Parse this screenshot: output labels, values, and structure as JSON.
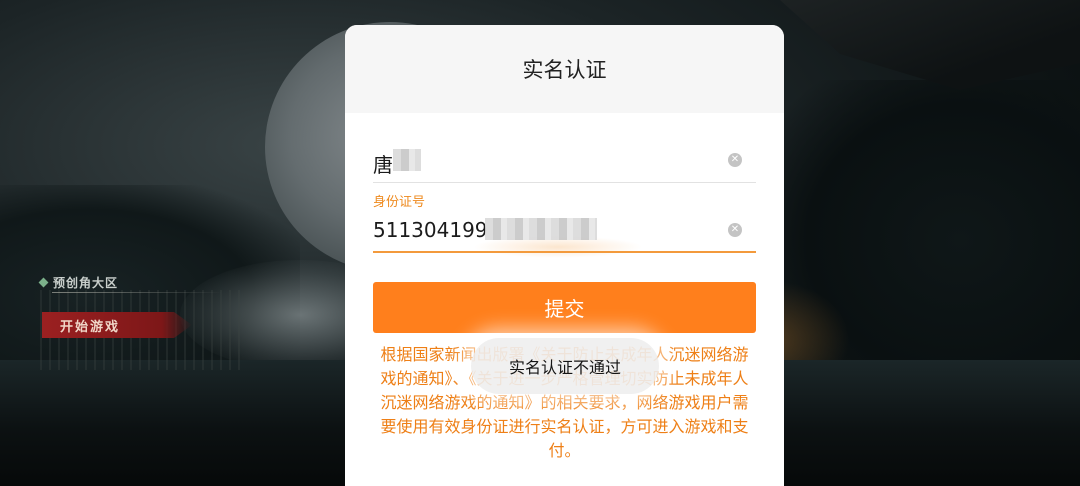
{
  "game_menu": {
    "server_label": "预创角大区",
    "start_label": "开始游戏"
  },
  "dialog": {
    "title": "实名认证",
    "name_field": {
      "value": "唐"
    },
    "id_field": {
      "label": "身份证号",
      "value": "511304199"
    },
    "submit_label": "提交",
    "notice_text": "根据国家新闻出版署《关于防止未成年人沉迷网络游戏的通知》、《关于进一步严格管理切实防止未成年人沉迷网络游戏的通知》的相关要求，网络游戏用户需要使用有效身份证进行实名认证，方可进入游戏和支付。"
  },
  "toast": {
    "message": "实名认证不通过"
  },
  "icons": {
    "clear": "clear-icon",
    "server": "diamond-icon"
  },
  "colors": {
    "accent": "#ff7f1c",
    "notice": "#ee7f16",
    "start_button": "#9b2021"
  }
}
